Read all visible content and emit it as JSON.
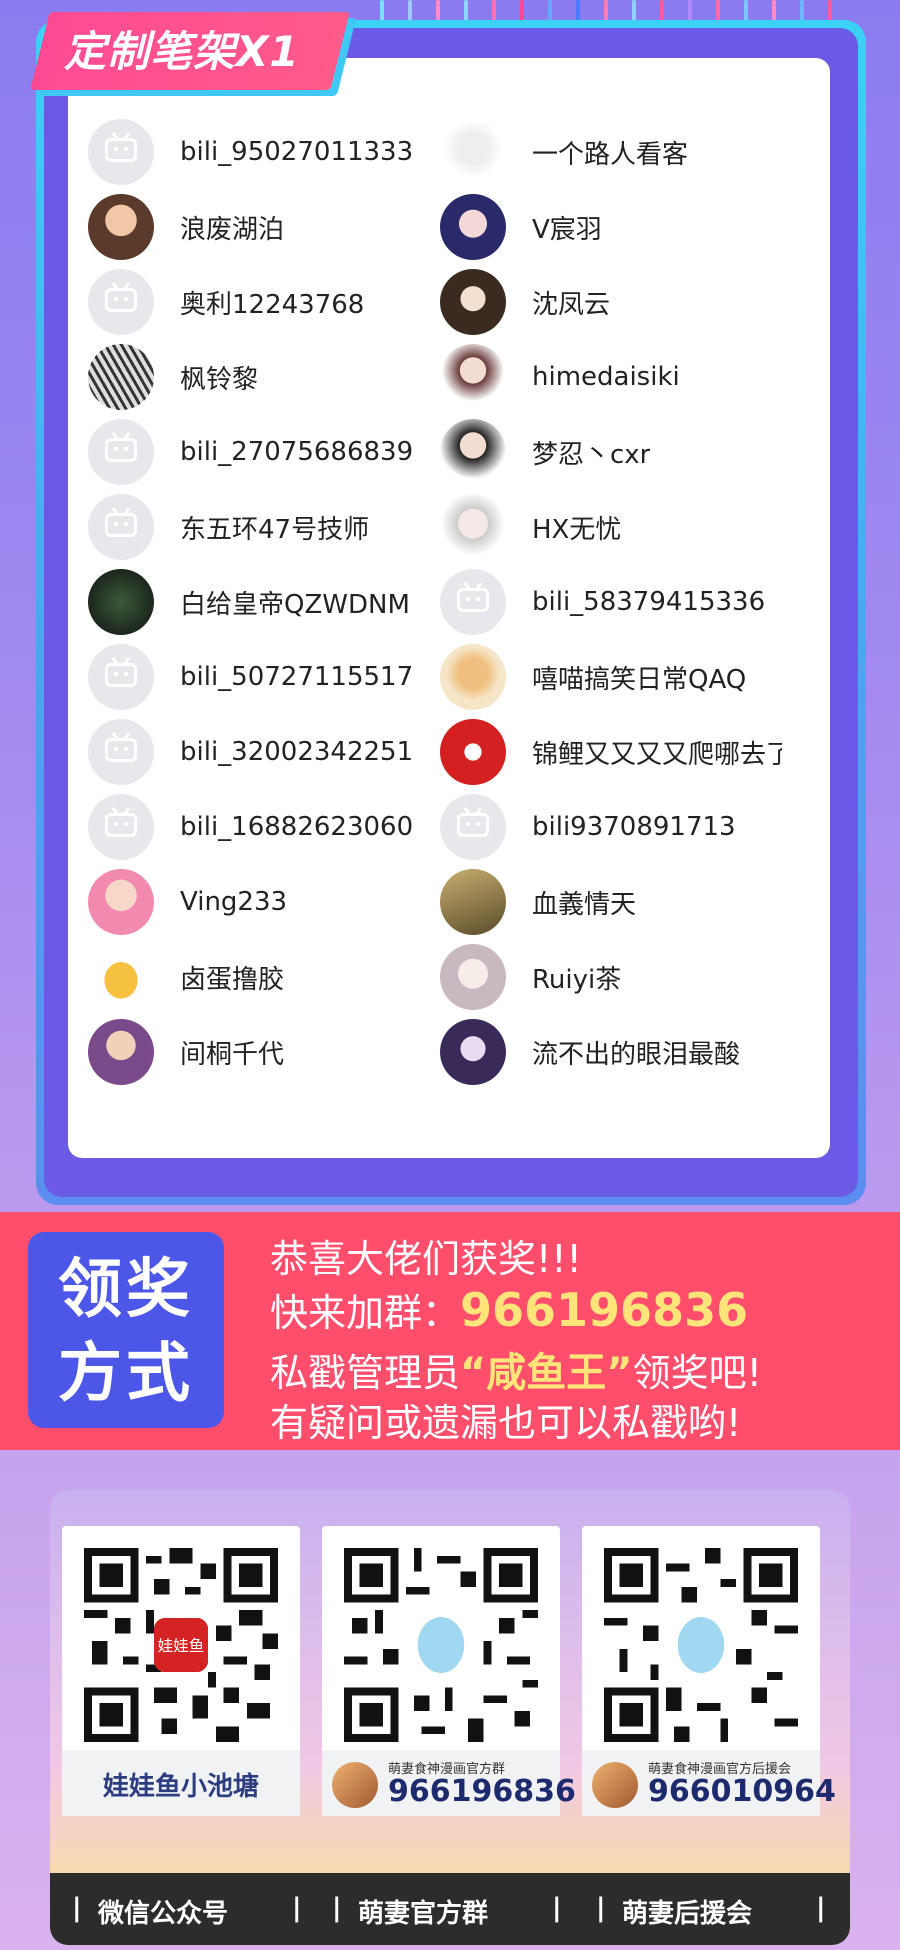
{
  "header": {
    "badge": "定制笔架X1"
  },
  "users_left": [
    "bili_95027011333",
    "浪废湖泊",
    "奥利12243768",
    "枫铃黎",
    "bili_27075686839",
    "东五环47号技师",
    "白给皇帝QZWDNM",
    "bili_50727115517",
    "bili_32002342251",
    "bili_16882623060",
    "Ving233",
    "卤蛋撸胶",
    "间桐千代"
  ],
  "users_right": [
    "一个路人看客",
    "V宸羽",
    "沈凤云",
    "himedaisiki",
    "梦忍丶cxr",
    "HX无忧",
    "bili_58379415336",
    "嘻喵搞笑日常QAQ",
    "锦鲤又又又又爬哪去了",
    "bili9370891713",
    "血義情天",
    "Ruiyi茶",
    "流不出的眼泪最酸"
  ],
  "banner": {
    "box_line1": "领奖",
    "box_line2": "方式",
    "line1": "恭喜大佬们获奖!!!",
    "line2_prefix": "快来加群：",
    "line2_number": "966196836",
    "line3_prefix": "私戳管理员",
    "line3_name": "“咸鱼王”",
    "line3_suffix": "领奖吧!",
    "line4": "有疑问或遗漏也可以私戳哟!"
  },
  "qr": {
    "box1_name": "娃娃鱼小池塘",
    "box1_logo": "娃娃鱼",
    "box2_group": "萌妻食神漫画官方群",
    "box2_number": "966196836",
    "box3_group": "萌妻食神漫画官方后援会",
    "box3_number": "966010964"
  },
  "footer": {
    "item1": "微信公众号",
    "item2": "萌妻官方群",
    "item3": "萌妻后援会",
    "sep": "|"
  }
}
